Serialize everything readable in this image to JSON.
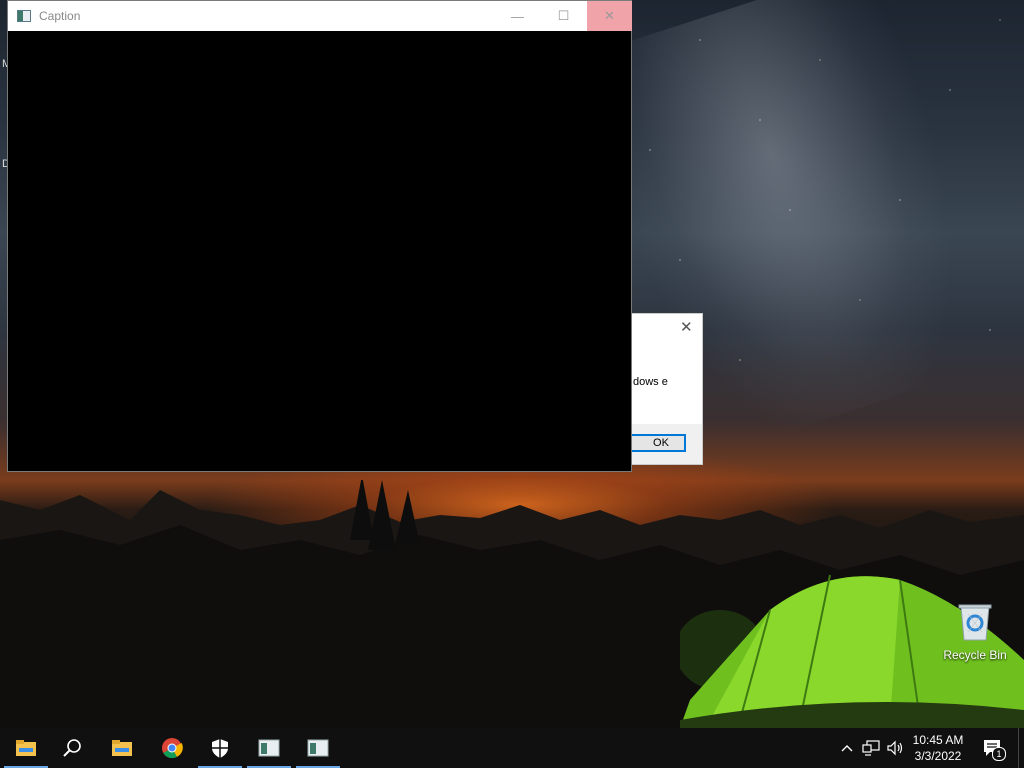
{
  "caption_window": {
    "title": "Caption",
    "minimize_glyph": "—",
    "maximize_glyph": "☐",
    "close_glyph": "✕"
  },
  "dialog": {
    "close_glyph": "✕",
    "message_fragment": "dows e",
    "ok_label": "OK"
  },
  "edge_text": [
    "M",
    "D"
  ],
  "desktop_icons": [
    {
      "label": "Recycle Bin",
      "icon": "recycle-bin-icon"
    }
  ],
  "taskbar": {
    "items": [
      {
        "icon": "file-explorer-icon",
        "active": true
      },
      {
        "icon": "search-icon",
        "active": false
      },
      {
        "icon": "folder-icon",
        "active": false
      },
      {
        "icon": "chrome-icon",
        "active": false
      },
      {
        "icon": "security-shield-icon",
        "active": true
      },
      {
        "icon": "app-window-icon",
        "active": true
      },
      {
        "icon": "app-window-icon",
        "active": true
      }
    ],
    "tray": {
      "chevron": "^",
      "time": "10:45 AM",
      "date": "3/3/2022",
      "notification_count": "1"
    }
  },
  "colors": {
    "taskbar_bg": "#101010",
    "accent": "#0078d7",
    "close_hover": "#f1a3aa",
    "tent_green": "#7ed321"
  }
}
